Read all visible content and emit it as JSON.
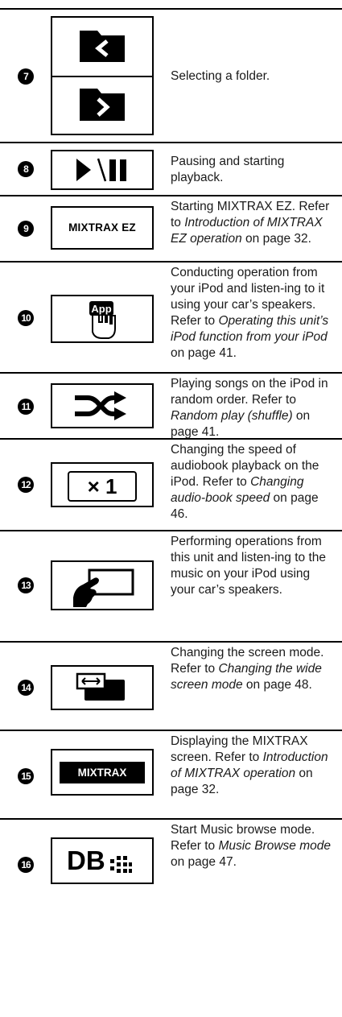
{
  "rows": [
    {
      "num": "7",
      "icon": "folder-navigation-icons",
      "text": "Selecting a folder.",
      "ref_pre": "",
      "ref_link": "",
      "ref_post": ""
    },
    {
      "num": "8",
      "icon": "play-pause-icon",
      "text": "Pausing and starting playback.",
      "ref_pre": "",
      "ref_link": "",
      "ref_post": ""
    },
    {
      "num": "9",
      "icon": "mixtrax-ez-icon",
      "icon_label": "MIXTRAX EZ",
      "text": "Starting MIXTRAX EZ.",
      "ref_pre": "Refer to ",
      "ref_link": "Introduction of MIXTRAX EZ operation",
      "ref_post": " on page 32."
    },
    {
      "num": "10",
      "icon": "app-mode-hand-icon",
      "icon_label": "App",
      "text": "Conducting operation from your iPod and listen-ing to it using your car’s speakers.",
      "ref_pre": "Refer to ",
      "ref_link": "Operating this unit’s iPod function from your iPod",
      "ref_post": " on page 41."
    },
    {
      "num": "11",
      "icon": "shuffle-icon",
      "text": "Playing songs on the iPod in random order.",
      "ref_pre": "Refer to ",
      "ref_link": "Random play (shuffle)",
      "ref_post": " on page 41."
    },
    {
      "num": "12",
      "icon": "audiobook-speed-icon",
      "icon_label": "× 1",
      "text": "Changing the speed of audiobook playback on the iPod.",
      "ref_pre": "Refer to ",
      "ref_link": "Changing audio-book speed",
      "ref_post": " on page 46."
    },
    {
      "num": "13",
      "icon": "control-mode-hand-icon",
      "text": "Performing operations from this unit and listen-ing to the music on your iPod using your car’s speakers.",
      "ref_pre": "",
      "ref_link": "",
      "ref_post": ""
    },
    {
      "num": "14",
      "icon": "wide-screen-mode-icon",
      "text": "Changing the screen mode.",
      "ref_pre": "Refer to ",
      "ref_link": "Changing the wide screen mode",
      "ref_post": " on page 48."
    },
    {
      "num": "15",
      "icon": "mixtrax-icon",
      "icon_label": "MIXTRAX",
      "text": "Displaying the MIXTRAX screen.",
      "ref_pre": "Refer to ",
      "ref_link": "Introduction of MIXTRAX operation",
      "ref_post": " on page 32."
    },
    {
      "num": "16",
      "icon": "music-browse-db-icon",
      "icon_label": "DB",
      "text": "Start Music browse mode.",
      "ref_pre": "Refer to ",
      "ref_link": "Music Browse mode",
      "ref_post": " on page 47."
    }
  ]
}
